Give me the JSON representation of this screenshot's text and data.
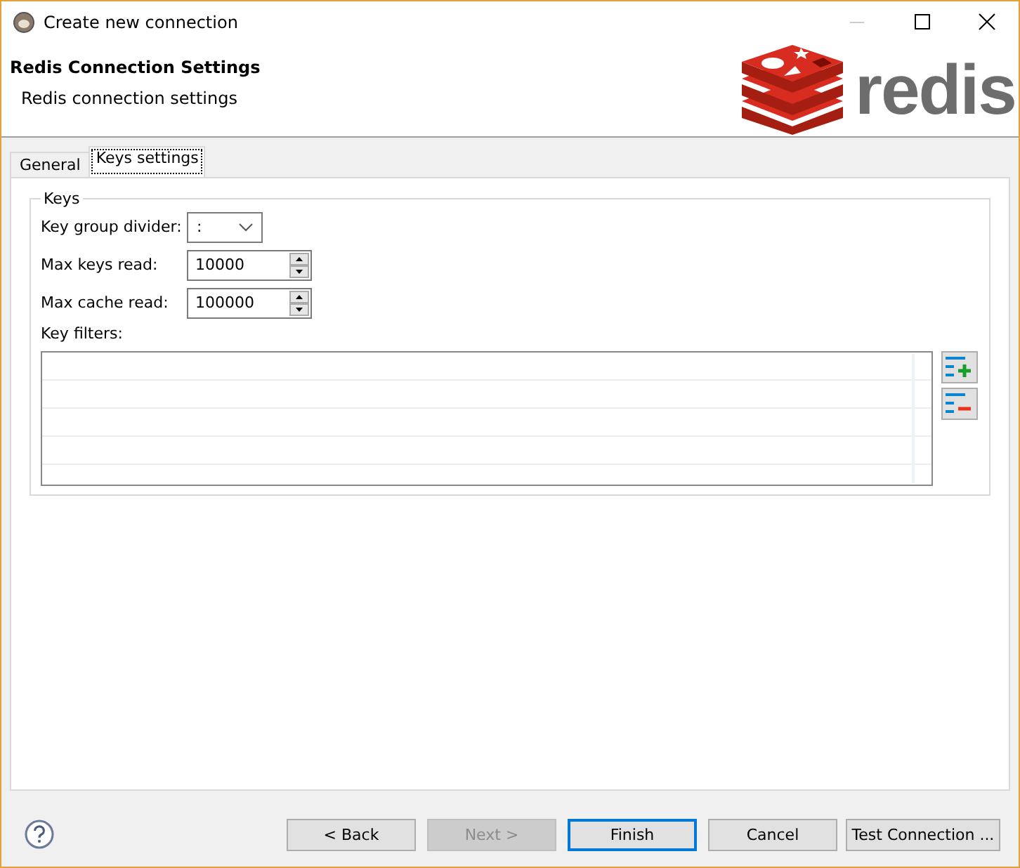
{
  "window": {
    "title": "Create new connection"
  },
  "header": {
    "title": "Redis Connection Settings",
    "subtitle": "Redis connection settings",
    "logo_text": "redis"
  },
  "tabs": [
    {
      "label": "General",
      "selected": false
    },
    {
      "label": "Keys settings",
      "selected": true
    }
  ],
  "keys_group": {
    "title": "Keys",
    "fields": [
      {
        "kind": "combo",
        "label": "Key group divider:",
        "value": ":"
      },
      {
        "kind": "spinner",
        "label": "Max keys read:",
        "value": "10000"
      },
      {
        "kind": "spinner",
        "label": "Max cache read:",
        "value": "100000"
      }
    ],
    "filters_label": "Key filters:"
  },
  "buttons": [
    {
      "label": "< Back",
      "disabled": false,
      "default": false
    },
    {
      "label": "Next >",
      "disabled": true,
      "default": false
    },
    {
      "label": "Finish",
      "disabled": false,
      "default": true
    },
    {
      "label": "Cancel",
      "disabled": false,
      "default": false
    },
    {
      "label": "Test Connection ...",
      "disabled": false,
      "default": false
    }
  ]
}
